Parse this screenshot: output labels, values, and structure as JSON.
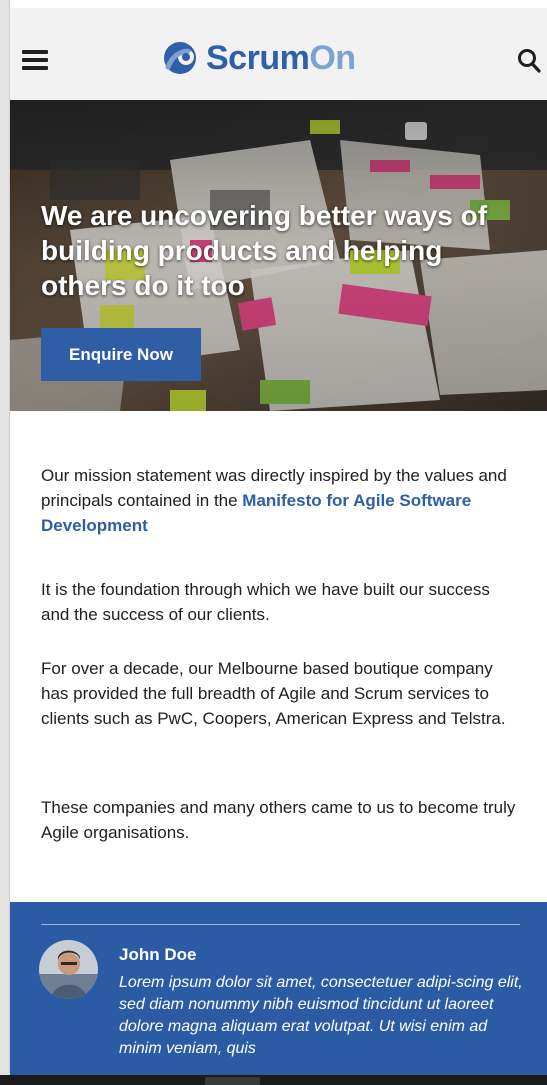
{
  "header": {
    "logo_text_a": "Scrum",
    "logo_text_b": "On",
    "colors": {
      "brand_blue": "#2f5fa8",
      "brand_light": "#7da2d2"
    },
    "menu_icon": "hamburger-menu-icon",
    "search_icon": "search-icon"
  },
  "hero": {
    "title": "We are uncovering better ways of building products and helping others do it too",
    "cta_label": "Enquire Now",
    "cta_color": "#2f5ea6"
  },
  "content": {
    "p1_text": "Our mission statement was directly inspired by the values and principals contained in the ",
    "p1_link": "Manifesto for Agile Software Development",
    "p2": "It is the foundation through which we have built our success and the success of our clients.",
    "p3": "For over a decade, our Melbourne based boutique company has provided the full breadth of Agile and Scrum services to clients such as PwC, Coopers, American Express and Telstra.",
    "p4": "These companies and many others came to us to become truly Agile organisations."
  },
  "testimonial": {
    "name": "John Doe",
    "quote": "Lorem ipsum dolor sit amet, consectetuer adipi-scing elit, sed diam nonummy nibh euismod tincidunt ut laoreet dolore magna aliquam erat volutpat. Ut wisi enim ad minim veniam, quis",
    "background": "#2c5ba6"
  }
}
